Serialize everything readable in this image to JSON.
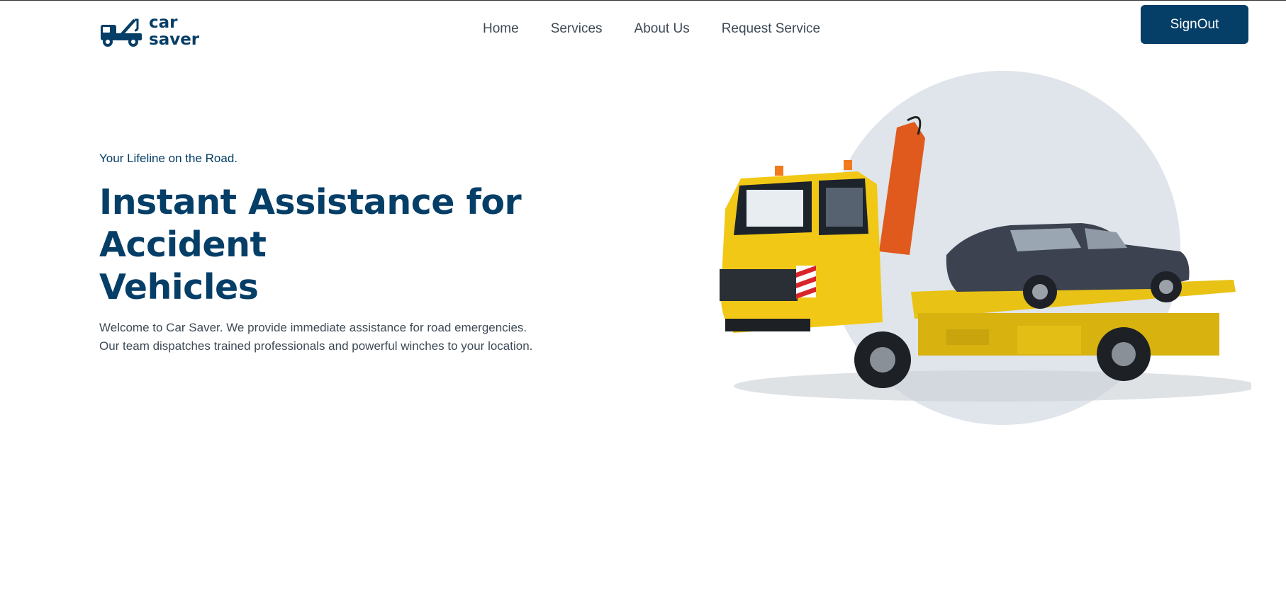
{
  "brand": {
    "line1": "car",
    "line2": "saver",
    "color": "#053e67"
  },
  "nav": {
    "items": [
      {
        "label": "Home"
      },
      {
        "label": "Services"
      },
      {
        "label": "About Us"
      },
      {
        "label": "Request Service"
      }
    ]
  },
  "header": {
    "signout_label": "SignOut"
  },
  "hero": {
    "tagline": "Your Lifeline on the Road.",
    "title_line1": "Instant Assistance for Accident",
    "title_line2": "Vehicles",
    "desc_line1": "Welcome to Car Saver. We provide immediate assistance for road emergencies.",
    "desc_line2": "Our team dispatches trained professionals and powerful winches to your location.",
    "image_icon": "tow-truck-with-damaged-car-image",
    "circle_color": "#dfe5ea"
  }
}
